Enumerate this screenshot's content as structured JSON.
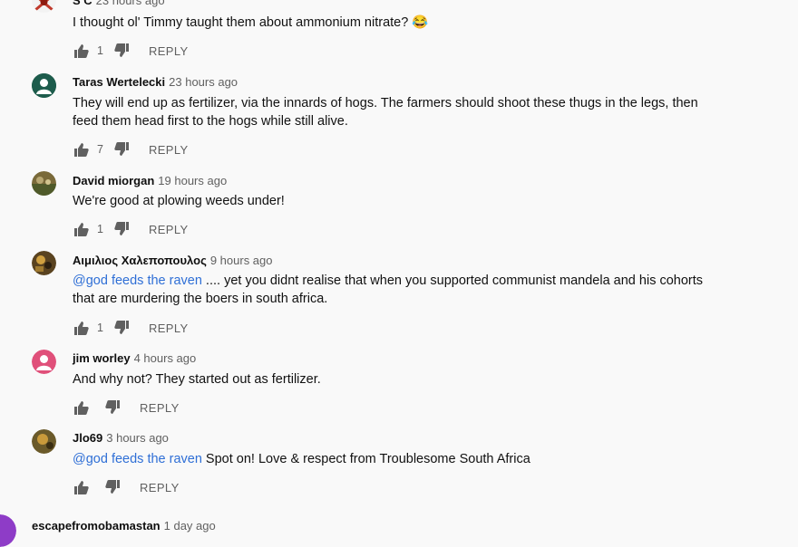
{
  "comments": [
    {
      "author": "S C",
      "time": "23 hours ago",
      "text": "I thought ol' Timmy taught them about ammonium nitrate? 😂",
      "likes": "1",
      "reply": "REPLY"
    },
    {
      "author": "Taras Wertelecki",
      "time": "23 hours ago",
      "text_line1": "They will end up as fertilizer, via the innards of hogs. The farmers should shoot these thugs in the legs, then",
      "text_line2": "feed them head first to the hogs while still alive.",
      "likes": "7",
      "reply": "REPLY"
    },
    {
      "author": "David miorgan",
      "time": "19 hours ago",
      "text": "We're good at plowing weeds under!",
      "likes": "1",
      "reply": "REPLY"
    },
    {
      "author": "Αιμιλιος Χαλεποπουλος",
      "time": "9 hours ago",
      "mention": "@god feeds the raven",
      "text_line1": " .... yet you didnt realise that when you supported communist mandela and his cohorts",
      "text_line2": "that are murdering the boers in south africa.",
      "likes": "1",
      "reply": "REPLY"
    },
    {
      "author": "jim worley",
      "time": "4 hours ago",
      "text": "And why not?  They started out as fertilizer.",
      "reply": "REPLY"
    },
    {
      "author": "Jlo69",
      "time": "3 hours ago",
      "mention": "@god feeds the raven",
      "text": " Spot on! Love & respect from Troublesome South Africa",
      "reply": "REPLY"
    },
    {
      "author": "escapefromobamastan",
      "time": "1 day ago"
    }
  ],
  "colors": {
    "background": "#f9f9f9",
    "mention": "#2f6fd6",
    "meta": "#606060"
  },
  "icons": [
    "thumbs-up-icon",
    "thumbs-down-icon"
  ]
}
